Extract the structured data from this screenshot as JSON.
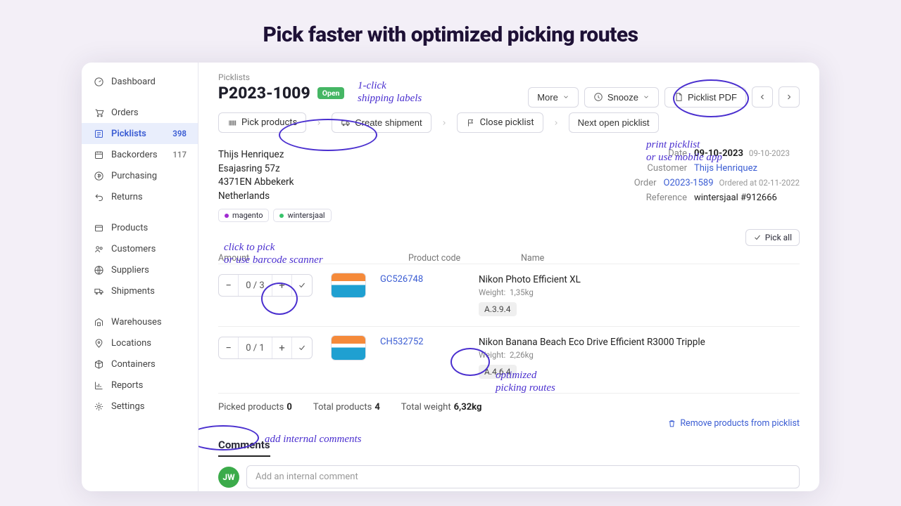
{
  "hero": "Pick faster with optimized picking routes",
  "sidebar": {
    "items": [
      {
        "label": "Dashboard"
      },
      {
        "label": "Orders"
      },
      {
        "label": "Picklists",
        "count": "398",
        "active": true
      },
      {
        "label": "Backorders",
        "count": "117"
      },
      {
        "label": "Purchasing"
      },
      {
        "label": "Returns"
      },
      {
        "label": "Products"
      },
      {
        "label": "Customers"
      },
      {
        "label": "Suppliers"
      },
      {
        "label": "Shipments"
      },
      {
        "label": "Warehouses"
      },
      {
        "label": "Locations"
      },
      {
        "label": "Containers"
      },
      {
        "label": "Reports"
      },
      {
        "label": "Settings"
      }
    ]
  },
  "crumb": "Picklists",
  "title": "P2023-1009",
  "status_badge": "Open",
  "actions": {
    "more": "More",
    "snooze": "Snooze",
    "pdf": "Picklist PDF"
  },
  "steps": {
    "pick": "Pick products",
    "ship": "Create shipment",
    "close": "Close picklist",
    "next": "Next open picklist"
  },
  "address": {
    "name": "Thijs Henriquez",
    "line1": "Esajasring 57z",
    "line2": "4371EN Abbekerk",
    "country": "Netherlands"
  },
  "tags": [
    {
      "label": "magento",
      "dot": "#a02ad1"
    },
    {
      "label": "wintersjaal",
      "dot": "#37c36a"
    }
  ],
  "meta": {
    "date_label": "Date",
    "date": "09-10-2023",
    "date_sub": "09-10-2023",
    "customer_label": "Customer",
    "customer": "Thijs Henriquez",
    "order_label": "Order",
    "order": "O2023-1589",
    "order_sub": "Ordered at 02-11-2022",
    "reference_label": "Reference",
    "reference": "wintersjaal #912666"
  },
  "pick_all": "Pick all",
  "cols": {
    "amount": "Amount",
    "code": "Product code",
    "name": "Name"
  },
  "lines": [
    {
      "qty": "0 / 3",
      "code": "GC526748",
      "name": "Nikon Photo Efficient XL",
      "weight_label": "Weight:",
      "weight": "1,35kg",
      "loc": "A.3.9.4"
    },
    {
      "qty": "0 / 1",
      "code": "CH532752",
      "name": "Nikon Banana Beach Eco Drive Efficient R3000 Tripple",
      "weight_label": "Weight:",
      "weight": "2,26kg",
      "loc": "A.4.6.4"
    }
  ],
  "totals": {
    "picked_label": "Picked products",
    "picked": "0",
    "total_label": "Total products",
    "total": "4",
    "weight_label": "Total weight",
    "weight": "6,32kg"
  },
  "remove_link": "Remove products from picklist",
  "comments": {
    "tab": "Comments",
    "avatar": "JW",
    "placeholder": "Add an internal comment"
  },
  "annotations": {
    "shipping": "1-click\nshipping labels",
    "pdf": "print picklist\nor use mobile app",
    "pick": "click to pick\nor use barcode scanner",
    "routes": "optimized\npicking routes",
    "comments": "add internal comments"
  }
}
